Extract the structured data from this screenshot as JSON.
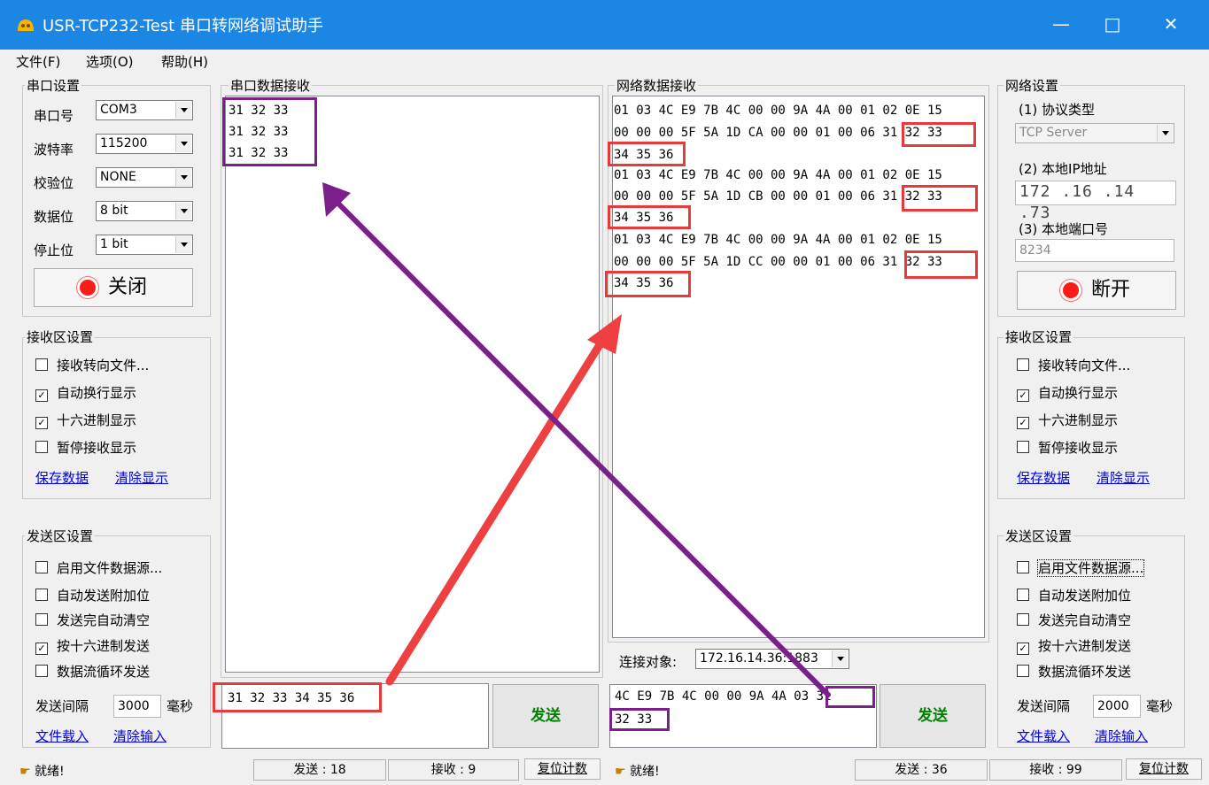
{
  "window": {
    "title": "USR-TCP232-Test 串口转网络调试助手",
    "minimize": "—",
    "maximize": "□",
    "close": "✕"
  },
  "menu": [
    "文件(F)",
    "选项(O)",
    "帮助(H)"
  ],
  "serial_settings": {
    "title": "串口设置",
    "port_label": "串口号",
    "port": "COM3",
    "baud_label": "波特率",
    "baud": "115200",
    "parity_label": "校验位",
    "parity": "NONE",
    "databits_label": "数据位",
    "databits": "8 bit",
    "stopbits_label": "停止位",
    "stopbits": "1 bit",
    "button": "关闭"
  },
  "left_recv_settings": {
    "title": "接收区设置",
    "options": [
      {
        "label": "接收转向文件...",
        "checked": false
      },
      {
        "label": "自动换行显示",
        "checked": true
      },
      {
        "label": "十六进制显示",
        "checked": true
      },
      {
        "label": "暂停接收显示",
        "checked": false
      }
    ],
    "save": "保存数据",
    "clear": "清除显示"
  },
  "left_send_settings": {
    "title": "发送区设置",
    "options": [
      {
        "label": "启用文件数据源...",
        "checked": false
      },
      {
        "label": "自动发送附加位",
        "checked": false
      },
      {
        "label": "发送完自动清空",
        "checked": false
      },
      {
        "label": "按十六进制发送",
        "checked": true
      },
      {
        "label": "数据流循环发送",
        "checked": false
      }
    ],
    "interval_label": "发送间隔",
    "interval": "3000",
    "interval_unit": "毫秒",
    "load": "文件载入",
    "clear": "清除输入"
  },
  "serial_recv": {
    "title": "串口数据接收",
    "lines": [
      "31 32 33",
      "31 32 33",
      "31 32 33"
    ]
  },
  "serial_send": {
    "text": "31 32 33 34 35 36",
    "button": "发送"
  },
  "net_recv": {
    "title": "网络数据接收",
    "lines": [
      "01 03 4C E9 7B 4C 00 00 9A 4A 00 01 02 0E 15",
      "00 00 00 5F 5A 1D CA 00 00 01 00 06 31 32 33",
      "34 35 36",
      "01 03 4C E9 7B 4C 00 00 9A 4A 00 01 02 0E 15",
      "00 00 00 5F 5A 1D CB 00 00 01 00 06 31 32 33",
      "34 35 36",
      "01 03 4C E9 7B 4C 00 00 9A 4A 00 01 02 0E 15",
      "00 00 00 5F 5A 1D CC 00 00 01 00 06 31 32 33",
      "34 35 36"
    ]
  },
  "net_target": {
    "label": "连接对象:",
    "value": "172.16.14.36:1883"
  },
  "net_send": {
    "line1": "4C E9 7B 4C 00 00 9A 4A 03 31",
    "line2": "32 33",
    "button": "发送"
  },
  "net_settings": {
    "title": "网络设置",
    "proto_label": "(1) 协议类型",
    "proto": "TCP Server",
    "ip_label": "(2) 本地IP地址",
    "ip": [
      "172",
      "16",
      "14",
      "73"
    ],
    "port_label": "(3) 本地端口号",
    "port": "8234",
    "button": "断开"
  },
  "right_recv_settings": {
    "title": "接收区设置",
    "options": [
      {
        "label": "接收转向文件...",
        "checked": false
      },
      {
        "label": "自动换行显示",
        "checked": true
      },
      {
        "label": "十六进制显示",
        "checked": true
      },
      {
        "label": "暂停接收显示",
        "checked": false
      }
    ],
    "save": "保存数据",
    "clear": "清除显示"
  },
  "right_send_settings": {
    "title": "发送区设置",
    "options": [
      {
        "label": "启用文件数据源...",
        "checked": false
      },
      {
        "label": "自动发送附加位",
        "checked": false
      },
      {
        "label": "发送完自动清空",
        "checked": false
      },
      {
        "label": "按十六进制发送",
        "checked": true
      },
      {
        "label": "数据流循环发送",
        "checked": false
      }
    ],
    "interval_label": "发送间隔",
    "interval": "2000",
    "interval_unit": "毫秒",
    "load": "文件载入",
    "clear": "清除输入"
  },
  "status_left": {
    "ready": "就绪!",
    "sent": "发送 : 18",
    "recv": "接收 : 9",
    "reset": "复位计数"
  },
  "status_right": {
    "ready": "就绪!",
    "sent": "发送 : 36",
    "recv": "接收 : 99",
    "reset": "复位计数"
  },
  "colors": {
    "title_bar": "#1c86e5",
    "highlight_red": "#e83a3a",
    "highlight_purple": "#7b1f8a"
  }
}
